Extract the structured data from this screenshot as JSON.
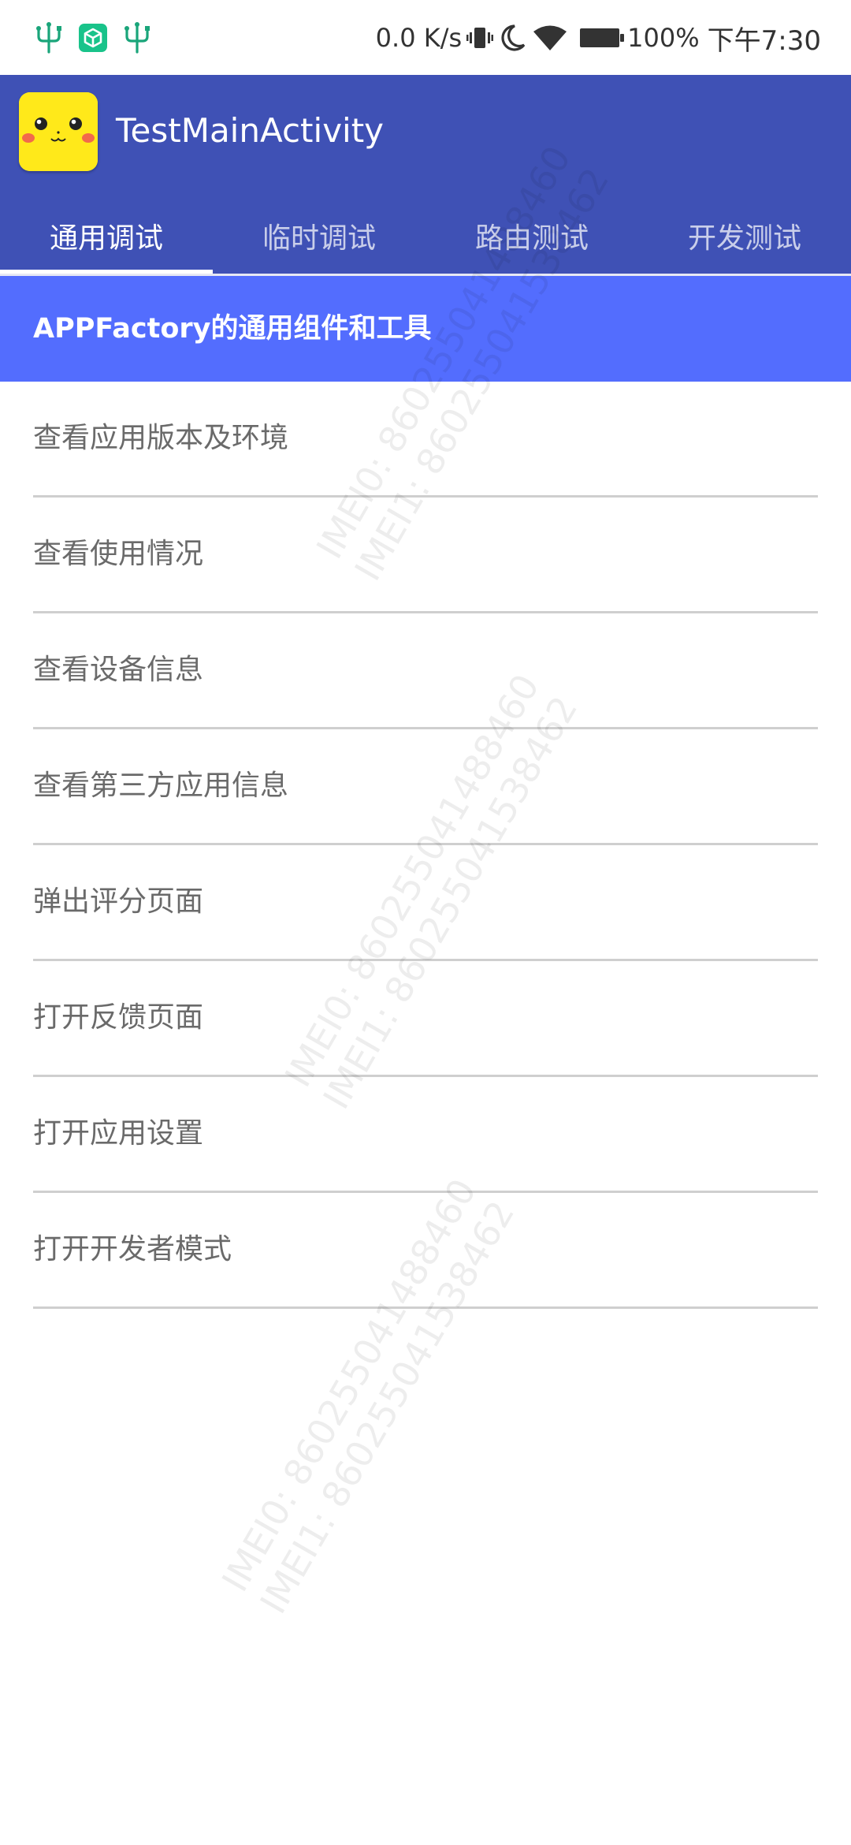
{
  "status_bar": {
    "icons_left": [
      "usb-icon",
      "app-notification-icon",
      "usb-icon"
    ],
    "network_speed": "0.0 K/s",
    "icons_right": [
      "vibrate-icon",
      "do-not-disturb-moon-icon",
      "wifi-icon",
      "battery-icon"
    ],
    "battery_percent": "100%",
    "time": "下午7:30"
  },
  "app_bar": {
    "title": "TestMainActivity",
    "logo_icon": "pikachu-face-icon",
    "background_color": "#3f51b5"
  },
  "tabs": [
    {
      "label": "通用调试",
      "selected": true
    },
    {
      "label": "临时调试",
      "selected": false
    },
    {
      "label": "路由测试",
      "selected": false
    },
    {
      "label": "开发测试",
      "selected": false
    }
  ],
  "section": {
    "title": "APPFactory的通用组件和工具",
    "background_color": "#536dfe"
  },
  "menu_items": [
    {
      "label": "查看应用版本及环境"
    },
    {
      "label": "查看使用情况"
    },
    {
      "label": "查看设备信息"
    },
    {
      "label": "查看第三方应用信息"
    },
    {
      "label": "弹出评分页面"
    },
    {
      "label": "打开反馈页面"
    },
    {
      "label": "打开应用设置"
    },
    {
      "label": "打开开发者模式"
    }
  ],
  "watermark": {
    "line1": "IMEI0: 860255041488460",
    "line2": "IMEI1: 860255041538462"
  }
}
